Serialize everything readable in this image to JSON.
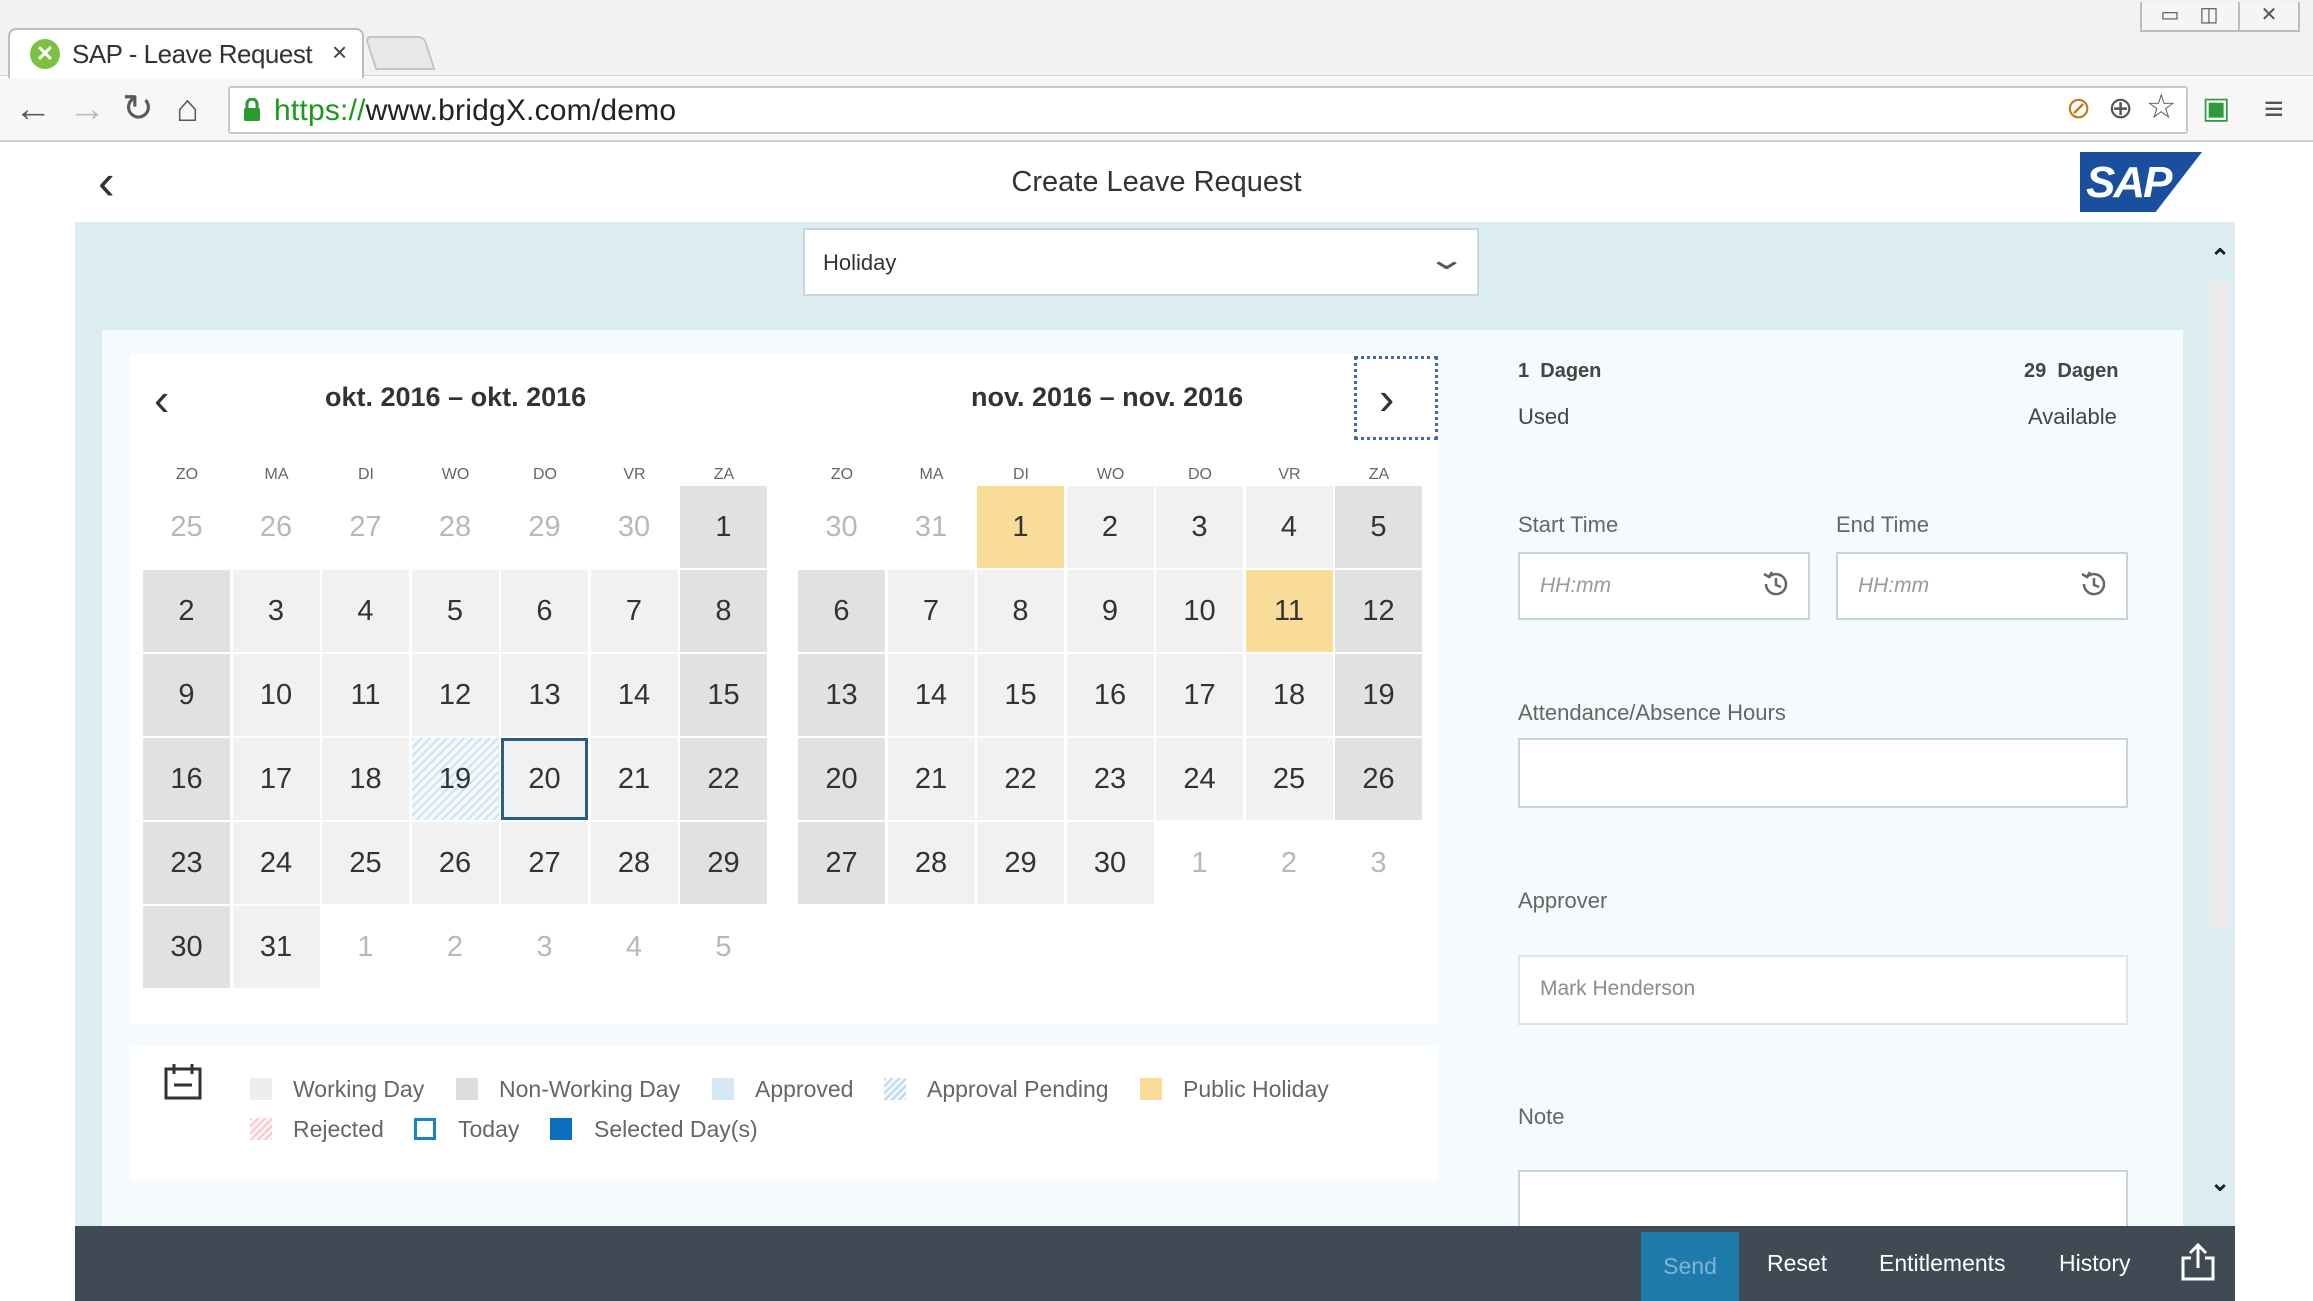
{
  "browser": {
    "tab_title": "SAP - Leave Request",
    "tab_close": "×",
    "url_scheme": "https://",
    "url_rest": "www.bridgX.com/demo"
  },
  "header": {
    "back_icon": "‹",
    "title": "Create Leave Request",
    "logo_text": "SAP"
  },
  "leave_type": {
    "value": "Holiday"
  },
  "calendar": {
    "weekdays": [
      "ZO",
      "MA",
      "DI",
      "WO",
      "DO",
      "VR",
      "ZA"
    ],
    "months": [
      {
        "title": "okt. 2016 – okt. 2016",
        "weeks": [
          [
            {
              "d": "25",
              "t": "other"
            },
            {
              "d": "26",
              "t": "other"
            },
            {
              "d": "27",
              "t": "other"
            },
            {
              "d": "28",
              "t": "other"
            },
            {
              "d": "29",
              "t": "other"
            },
            {
              "d": "30",
              "t": "other"
            },
            {
              "d": "1",
              "t": "nonwork"
            }
          ],
          [
            {
              "d": "2",
              "t": "nonwork"
            },
            {
              "d": "3",
              "t": "work"
            },
            {
              "d": "4",
              "t": "work"
            },
            {
              "d": "5",
              "t": "work"
            },
            {
              "d": "6",
              "t": "work"
            },
            {
              "d": "7",
              "t": "work"
            },
            {
              "d": "8",
              "t": "nonwork"
            }
          ],
          [
            {
              "d": "9",
              "t": "nonwork"
            },
            {
              "d": "10",
              "t": "work"
            },
            {
              "d": "11",
              "t": "work"
            },
            {
              "d": "12",
              "t": "work"
            },
            {
              "d": "13",
              "t": "work"
            },
            {
              "d": "14",
              "t": "work"
            },
            {
              "d": "15",
              "t": "nonwork"
            }
          ],
          [
            {
              "d": "16",
              "t": "nonwork"
            },
            {
              "d": "17",
              "t": "work"
            },
            {
              "d": "18",
              "t": "work"
            },
            {
              "d": "19",
              "t": "pending"
            },
            {
              "d": "20",
              "t": "today"
            },
            {
              "d": "21",
              "t": "work"
            },
            {
              "d": "22",
              "t": "nonwork"
            }
          ],
          [
            {
              "d": "23",
              "t": "nonwork"
            },
            {
              "d": "24",
              "t": "work"
            },
            {
              "d": "25",
              "t": "work"
            },
            {
              "d": "26",
              "t": "work"
            },
            {
              "d": "27",
              "t": "work"
            },
            {
              "d": "28",
              "t": "work"
            },
            {
              "d": "29",
              "t": "nonwork"
            }
          ],
          [
            {
              "d": "30",
              "t": "nonwork"
            },
            {
              "d": "31",
              "t": "work"
            },
            {
              "d": "1",
              "t": "other"
            },
            {
              "d": "2",
              "t": "other"
            },
            {
              "d": "3",
              "t": "other"
            },
            {
              "d": "4",
              "t": "other"
            },
            {
              "d": "5",
              "t": "other"
            }
          ]
        ]
      },
      {
        "title": "nov. 2016 – nov. 2016",
        "weeks": [
          [
            {
              "d": "30",
              "t": "other"
            },
            {
              "d": "31",
              "t": "other"
            },
            {
              "d": "1",
              "t": "holiday"
            },
            {
              "d": "2",
              "t": "work"
            },
            {
              "d": "3",
              "t": "work"
            },
            {
              "d": "4",
              "t": "work"
            },
            {
              "d": "5",
              "t": "nonwork"
            }
          ],
          [
            {
              "d": "6",
              "t": "nonwork"
            },
            {
              "d": "7",
              "t": "work"
            },
            {
              "d": "8",
              "t": "work"
            },
            {
              "d": "9",
              "t": "work"
            },
            {
              "d": "10",
              "t": "work"
            },
            {
              "d": "11",
              "t": "holiday"
            },
            {
              "d": "12",
              "t": "nonwork"
            }
          ],
          [
            {
              "d": "13",
              "t": "nonwork"
            },
            {
              "d": "14",
              "t": "work"
            },
            {
              "d": "15",
              "t": "work"
            },
            {
              "d": "16",
              "t": "work"
            },
            {
              "d": "17",
              "t": "work"
            },
            {
              "d": "18",
              "t": "work"
            },
            {
              "d": "19",
              "t": "nonwork"
            }
          ],
          [
            {
              "d": "20",
              "t": "nonwork"
            },
            {
              "d": "21",
              "t": "work"
            },
            {
              "d": "22",
              "t": "work"
            },
            {
              "d": "23",
              "t": "work"
            },
            {
              "d": "24",
              "t": "work"
            },
            {
              "d": "25",
              "t": "work"
            },
            {
              "d": "26",
              "t": "nonwork"
            }
          ],
          [
            {
              "d": "27",
              "t": "nonwork"
            },
            {
              "d": "28",
              "t": "work"
            },
            {
              "d": "29",
              "t": "work"
            },
            {
              "d": "30",
              "t": "work"
            },
            {
              "d": "1",
              "t": "other"
            },
            {
              "d": "2",
              "t": "other"
            },
            {
              "d": "3",
              "t": "other"
            }
          ]
        ]
      }
    ]
  },
  "legend": {
    "working_day": "Working Day",
    "non_working_day": "Non-Working Day",
    "approved": "Approved",
    "approval_pending": "Approval Pending",
    "public_holiday": "Public Holiday",
    "rejected": "Rejected",
    "today": "Today",
    "selected": "Selected Day(s)"
  },
  "balance": {
    "used_count": "1",
    "used_unit": "Dagen",
    "used_label": "Used",
    "available_count": "29",
    "available_unit": "Dagen",
    "available_label": "Available"
  },
  "form": {
    "start_time_label": "Start Time",
    "start_time_placeholder": "HH:mm",
    "end_time_label": "End Time",
    "end_time_placeholder": "HH:mm",
    "hours_label": "Attendance/Absence Hours",
    "approver_label": "Approver",
    "approver_value": "Mark Henderson",
    "note_label": "Note"
  },
  "footer": {
    "send": "Send",
    "reset": "Reset",
    "entitlements": "Entitlements",
    "history": "History"
  },
  "colors": {
    "accent": "#1d7aaa",
    "footer_bg": "#3f4a54",
    "public_holiday": "#f9dc97",
    "today_border": "#2a5e8a",
    "selected": "#0a6ebd"
  }
}
